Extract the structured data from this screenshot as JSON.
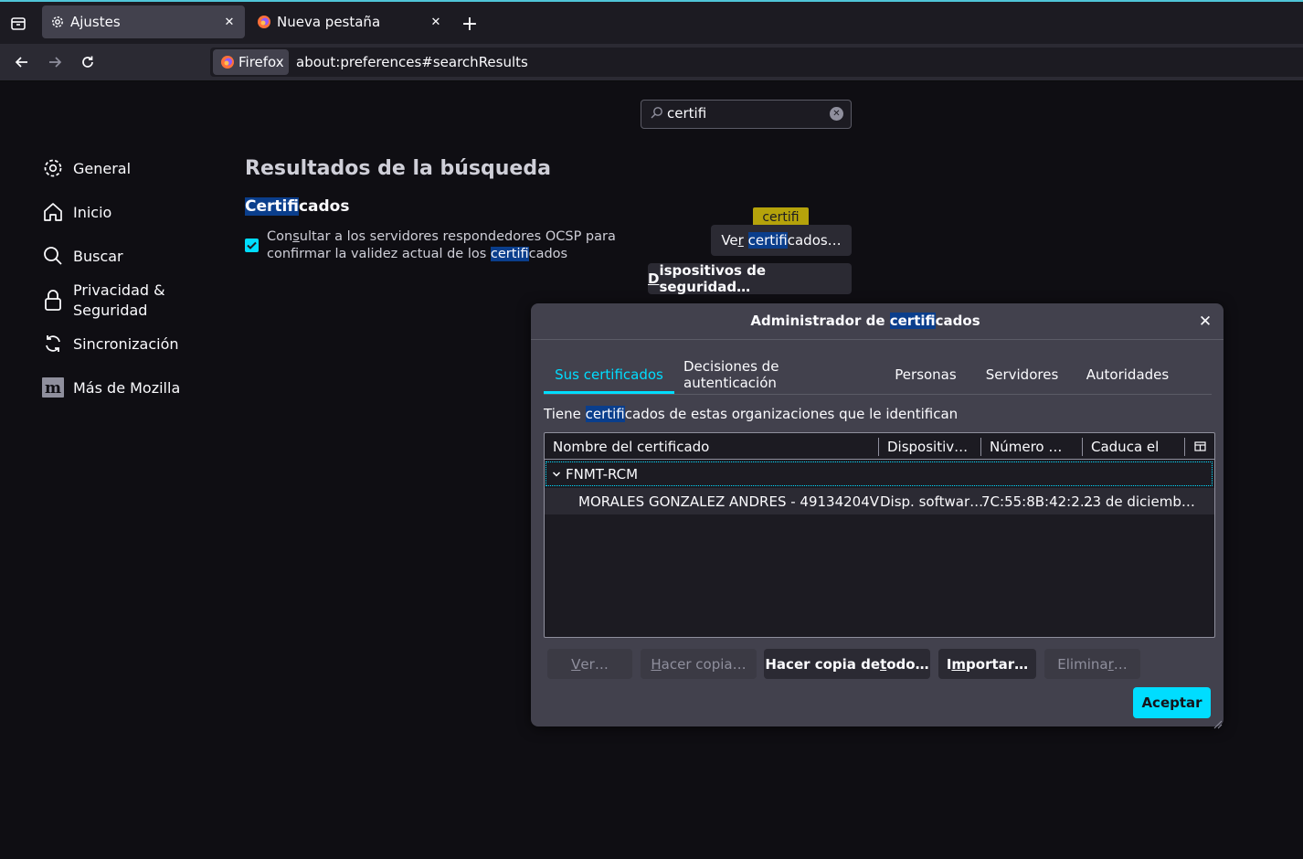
{
  "tabs": [
    {
      "label": "Ajustes",
      "icon": "gear-icon"
    },
    {
      "label": "Nueva pestaña",
      "icon": "firefox-icon"
    }
  ],
  "urlbar": {
    "identity_label": "Firefox",
    "url": "about:preferences#searchResults"
  },
  "prefs_search": {
    "value": "certifi"
  },
  "sidebar": {
    "items": [
      {
        "label": "General",
        "icon": "gear-icon"
      },
      {
        "label": "Inicio",
        "icon": "home-icon"
      },
      {
        "label": "Buscar",
        "icon": "search-icon"
      },
      {
        "label_line1": "Privacidad &",
        "label_line2": "Seguridad",
        "icon": "lock-icon"
      },
      {
        "label": "Sincronización",
        "icon": "sync-icon"
      },
      {
        "label": "Más de Mozilla",
        "icon": "mozilla-icon"
      }
    ]
  },
  "results": {
    "title": "Resultados de la búsqueda",
    "section_hl": "Certifi",
    "section_rest": "cados",
    "ocsp_pre": "Con",
    "ocsp_u": "s",
    "ocsp_post": "ultar a los servidores respondedores OCSP para",
    "ocsp_line2_pre": "confirmar la validez actual de los ",
    "ocsp_line2_hl": "certifi",
    "ocsp_line2_post": "cados",
    "ocsp_checked": true,
    "tooltip": "certifi",
    "view_btn_pre": "Ve",
    "view_btn_u": "r",
    "view_btn_space": " ",
    "view_btn_hl": "certifi",
    "view_btn_post": "cados…",
    "devices_btn_u": "D",
    "devices_btn_rest": "ispositivos de seguridad…"
  },
  "dialog": {
    "title_pre": "Administrador de ",
    "title_hl": "certifi",
    "title_post": "cados",
    "tabs": [
      "Sus certificados",
      "Decisiones de autenticación",
      "Personas",
      "Servidores",
      "Autoridades"
    ],
    "description_pre": "Tiene ",
    "description_hl": "certifi",
    "description_post": "cados de estas organizaciones que le identifican",
    "columns": [
      "Nombre del certificado",
      "Dispositiv…",
      "Número …",
      "Caduca el"
    ],
    "group": "FNMT-RCM",
    "row": {
      "name": "MORALES GONZALEZ ANDRES - 49134204V",
      "device": "Disp. softwar…",
      "serial": "7C:55:8B:42:2…",
      "expires": "23 de diciemb…"
    },
    "buttons": {
      "view_u": "V",
      "view_rest": "er…",
      "backup_u": "H",
      "backup_rest": "acer copia…",
      "backup_all_pre": "Hacer copia de ",
      "backup_all_u": "t",
      "backup_all_rest": "odo…",
      "import_pre": "I",
      "import_u": "m",
      "import_rest": "portar…",
      "delete_pre": "Elimina",
      "delete_u": "r",
      "delete_rest": "…",
      "accept": "Aceptar"
    }
  },
  "colors": {
    "accent": "#00ddff",
    "highlight": "#0a3e8c",
    "tooltip": "#b5a30b"
  }
}
